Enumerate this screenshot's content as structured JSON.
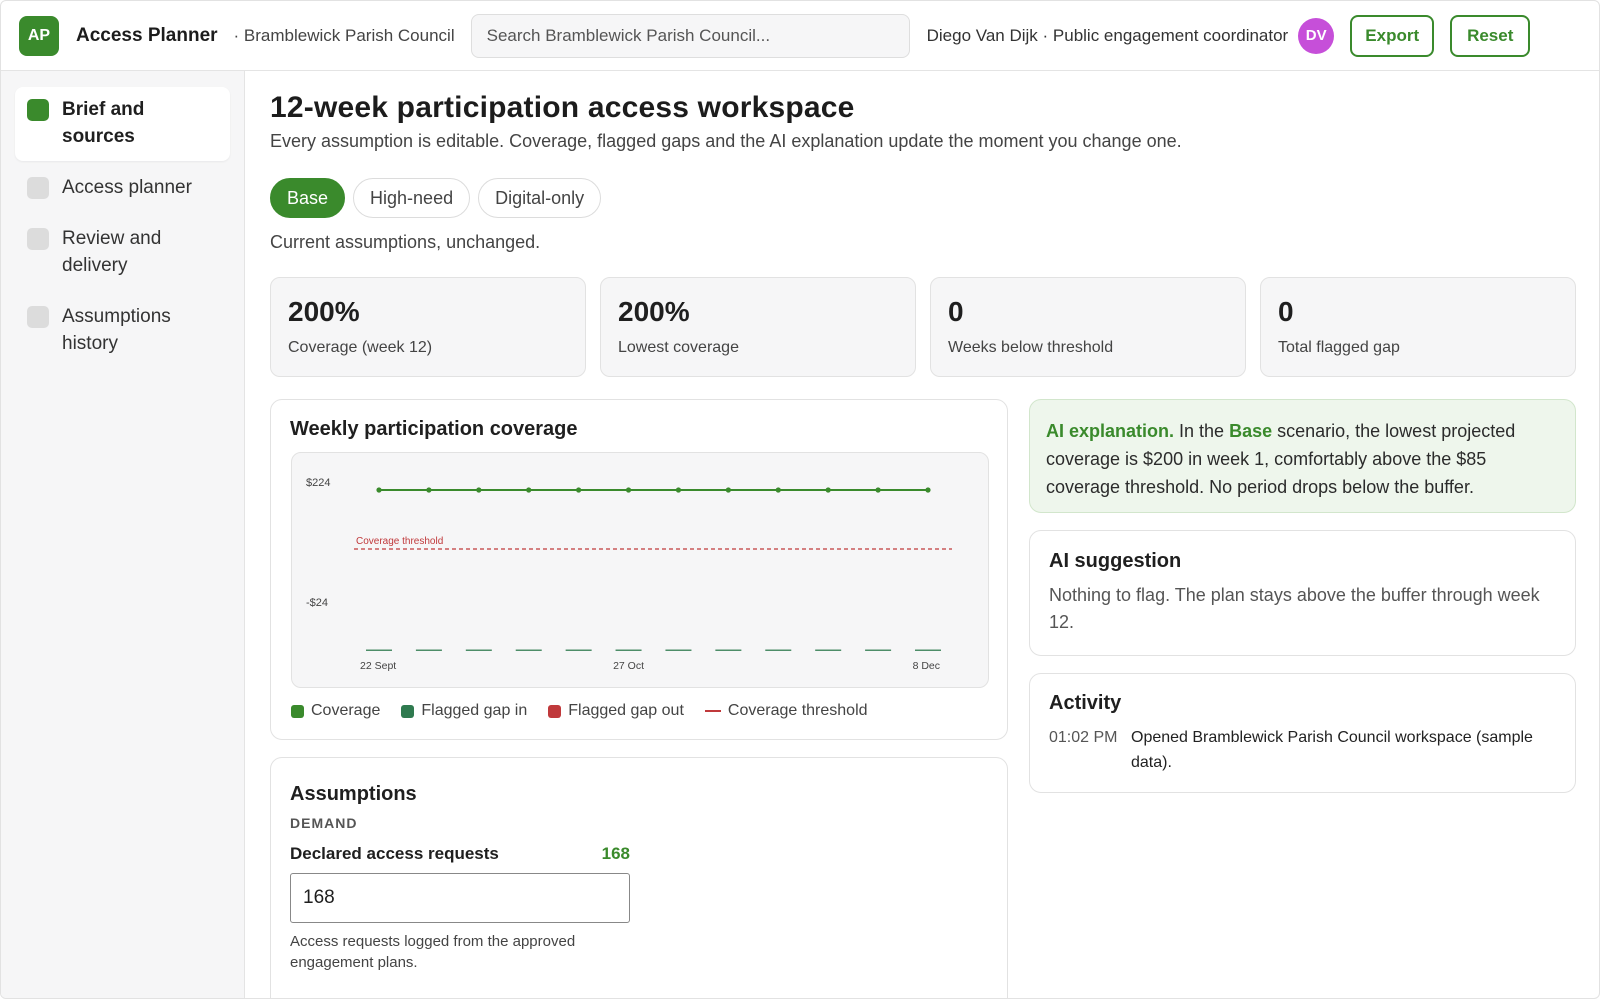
{
  "header": {
    "logo_initials": "AP",
    "app_name": "Access Planner",
    "org": "· Bramblewick Parish Council",
    "search_placeholder": "Search Bramblewick Parish Council...",
    "user_line": "Diego Van Dijk · Public engagement coordinator",
    "avatar_initials": "DV",
    "export_label": "Export",
    "reset_label": "Reset"
  },
  "sidebar": {
    "items": [
      {
        "label": "Brief and sources",
        "active": true
      },
      {
        "label": "Access planner",
        "active": false
      },
      {
        "label": "Review and delivery",
        "active": false
      },
      {
        "label": "Assumptions history",
        "active": false
      }
    ]
  },
  "main": {
    "title": "12-week participation access workspace",
    "subtitle": "Every assumption is editable. Coverage, flagged gaps and the AI explanation update the moment you change one.",
    "scenarios": [
      "Base",
      "High-need",
      "Digital-only"
    ],
    "active_scenario": "Base",
    "scenario_note": "Current assumptions, unchanged.",
    "stats": [
      {
        "value": "200%",
        "label": "Coverage (week 12)"
      },
      {
        "value": "200%",
        "label": "Lowest coverage"
      },
      {
        "value": "0",
        "label": "Weeks below threshold"
      },
      {
        "value": "0",
        "label": "Total flagged gap"
      }
    ]
  },
  "chart_card": {
    "title": "Weekly participation coverage",
    "legend": [
      "Coverage",
      "Flagged gap in",
      "Flagged gap out",
      "Coverage threshold"
    ]
  },
  "chart_data": {
    "type": "line",
    "title": "Weekly participation coverage",
    "x_tick_labels": [
      "22 Sept",
      "27 Oct",
      "8 Dec"
    ],
    "y_tick_labels": [
      "$224",
      "-$24"
    ],
    "ylim": [
      -24,
      224
    ],
    "series": [
      {
        "name": "Coverage",
        "type": "line",
        "values": [
          200,
          200,
          200,
          200,
          200,
          200,
          200,
          200,
          200,
          200,
          200,
          200
        ]
      },
      {
        "name": "Flagged gap in",
        "type": "bar",
        "values": [
          0,
          0,
          0,
          0,
          0,
          0,
          0,
          0,
          0,
          0,
          0,
          0
        ]
      },
      {
        "name": "Flagged gap out",
        "type": "bar",
        "values": [
          0,
          0,
          0,
          0,
          0,
          0,
          0,
          0,
          0,
          0,
          0,
          0
        ]
      }
    ],
    "threshold": {
      "name": "Coverage threshold",
      "value": 85,
      "label": "Coverage threshold"
    },
    "grid": false
  },
  "ai_explanation": {
    "lead": "AI explanation.",
    "text_1": " In the ",
    "scenario": "Base",
    "text_2": " scenario, the lowest projected coverage is $200 in week 1, comfortably above the $85 coverage threshold. No period drops below the buffer."
  },
  "ai_suggestion": {
    "title": "AI suggestion",
    "body": "Nothing to flag. The plan stays above the buffer through week 12."
  },
  "activity": {
    "title": "Activity",
    "entries": [
      {
        "time": "01:02 PM",
        "text": "Opened Bramblewick Parish Council workspace (sample data)."
      }
    ]
  },
  "assumptions": {
    "title": "Assumptions",
    "section": "DEMAND",
    "field_label": "Declared access requests",
    "field_value": "168",
    "field_input_value": "168",
    "field_help": "Access requests logged from the approved engagement plans."
  },
  "colors": {
    "accent": "#3a8a2c",
    "coverage": "#3a8a2c",
    "gap_in": "#2f7a4f",
    "gap_out": "#c0393b",
    "threshold": "#c0393b",
    "avatar": "#c64fd9"
  }
}
